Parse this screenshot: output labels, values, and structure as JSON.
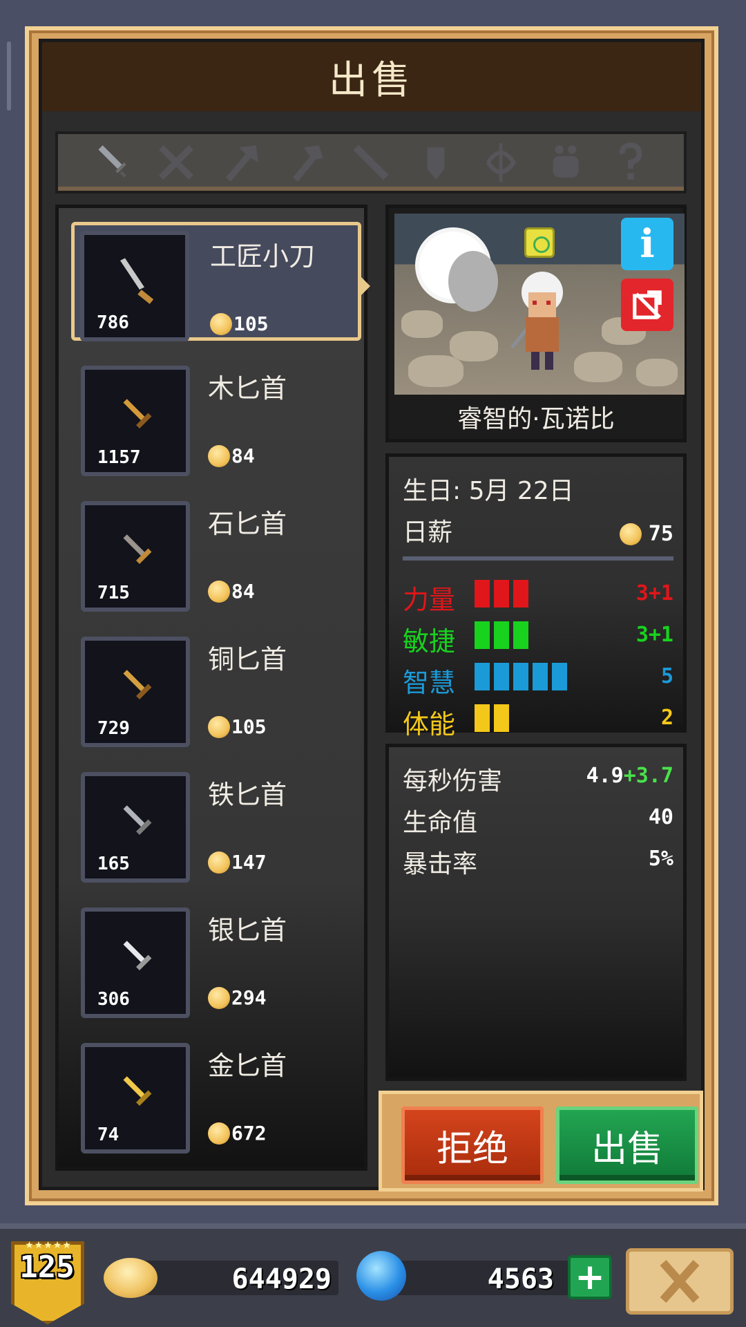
{
  "title": "出售",
  "category_tabs": [
    {
      "icon": "dagger-icon",
      "active": true
    },
    {
      "icon": "crossed-swords-icon",
      "active": false
    },
    {
      "icon": "axe-icon",
      "active": false
    },
    {
      "icon": "hammer-icon",
      "active": false
    },
    {
      "icon": "staff-icon",
      "active": false
    },
    {
      "icon": "shield-icon",
      "active": false
    },
    {
      "icon": "bow-icon",
      "active": false
    },
    {
      "icon": "pot-icon",
      "active": false
    },
    {
      "icon": "question-icon",
      "active": false
    }
  ],
  "items": [
    {
      "name": "工匠小刀",
      "stock": "786",
      "price": "105",
      "color": "#c9c9c9",
      "selected": true
    },
    {
      "name": "木匕首",
      "stock": "1157",
      "price": "84",
      "color": "#d49a3a"
    },
    {
      "name": "石匕首",
      "stock": "715",
      "price": "84",
      "color": "#9a948c"
    },
    {
      "name": "铜匕首",
      "stock": "729",
      "price": "105",
      "color": "#d4a040"
    },
    {
      "name": "铁匕首",
      "stock": "165",
      "price": "147",
      "color": "#b0b4ba"
    },
    {
      "name": "银匕首",
      "stock": "306",
      "price": "294",
      "color": "#e6e8ec"
    },
    {
      "name": "金匕首",
      "stock": "74",
      "price": "672",
      "color": "#f0c84a"
    }
  ],
  "hero": {
    "name": "睿智的·瓦诺比",
    "birthday": "生日: 5月 22日",
    "salary_label": "日薪",
    "salary_value": "75"
  },
  "attributes": [
    {
      "label": "力量",
      "value": "3+1",
      "bars": 3,
      "color": "#e0161a"
    },
    {
      "label": "敏捷",
      "value": "3+1",
      "bars": 3,
      "color": "#18d21e"
    },
    {
      "label": "智慧",
      "value": "5",
      "bars": 5,
      "color": "#1b9ad8"
    },
    {
      "label": "体能",
      "value": "2",
      "bars": 2,
      "color": "#f4c81a"
    }
  ],
  "combat": {
    "dps_label": "每秒伤害",
    "dps_base": "4.9",
    "dps_bonus": "+3.7",
    "hp_label": "生命值",
    "hp_value": "40",
    "crit_label": "暴击率",
    "crit_value": "5%"
  },
  "buttons": {
    "reject": "拒绝",
    "sell": "出售"
  },
  "footer": {
    "level": "125",
    "level_stars": "★★★★★",
    "gold": "644929",
    "gems": "4563",
    "add_label": "+"
  }
}
